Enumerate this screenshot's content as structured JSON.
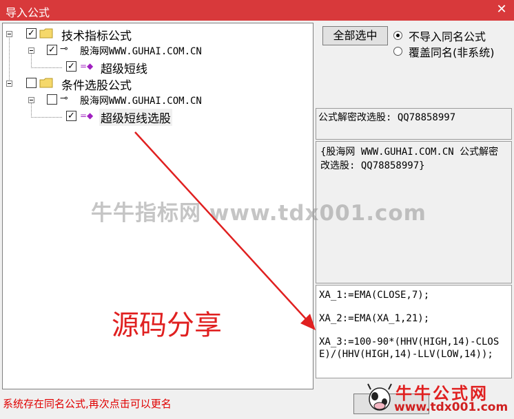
{
  "window": {
    "title": "导入公式",
    "close_icon": "close-icon"
  },
  "tree": {
    "group1": {
      "label": "技术指标公式",
      "checked": true,
      "source": {
        "label": "股海网WWW.GUHAI.COM.CN",
        "checked": true
      },
      "item": {
        "label": "超级短线",
        "checked": true
      }
    },
    "group2": {
      "label": "条件选股公式",
      "checked": false,
      "source": {
        "label": "股海网WWW.GUHAI.COM.CN",
        "checked": false
      },
      "item": {
        "label": "超级短线选股",
        "checked": true
      }
    }
  },
  "controls": {
    "select_all_label": "全部选中",
    "radio_no_import": "不导入同名公式",
    "radio_overwrite": "覆盖同名(非系统)"
  },
  "panels": {
    "password_info": "公式解密改选股: QQ78858997",
    "description": "{股海网 WWW.GUHAI.COM.CN 公式解密改选股: QQ78858997}",
    "source_code_lines": [
      "XA_1:=EMA(CLOSE,7);",
      "XA_2:=EMA(XA_1,21);",
      "XA_3:=100-90*(HHV(HIGH,14)-CLOSE)/(HHV(HIGH,14)-LLV(LOW,14));"
    ]
  },
  "overlay": {
    "watermark": "牛牛指标网 www.tdx001.com",
    "share_text": "源码分享",
    "brand_name": "牛牛公式网",
    "brand_url": "www.tdx001.com"
  },
  "status_message": "系统存在同名公式,再次点击可以更名",
  "colors": {
    "titlebar": "#d8393b",
    "status_text": "#e00000",
    "arrow": "#e02020"
  }
}
